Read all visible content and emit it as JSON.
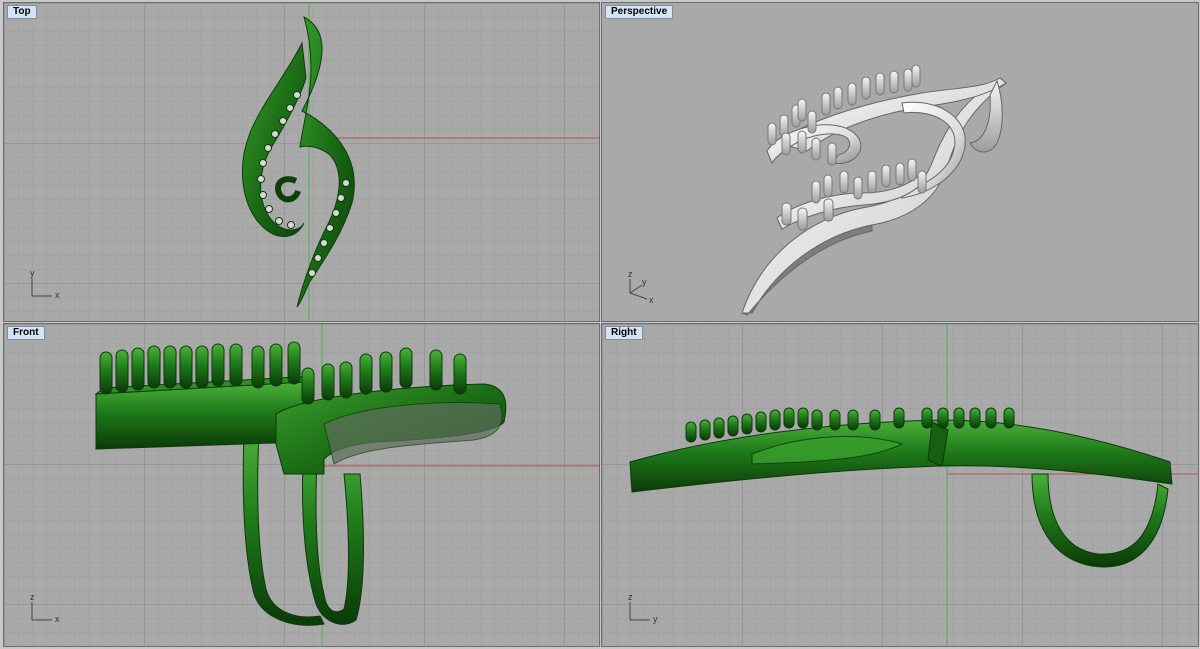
{
  "viewports": {
    "top": {
      "title": "Top",
      "axis_h": "x",
      "axis_v": "y"
    },
    "perspective": {
      "title": "Perspective",
      "axis_1": "z",
      "axis_2": "y",
      "axis_3": "x"
    },
    "front": {
      "title": "Front",
      "axis_h": "x",
      "axis_v": "z"
    },
    "right": {
      "title": "Right",
      "axis_h": "y",
      "axis_v": "z"
    }
  },
  "colors": {
    "viewport_bg": "#a9a9a9",
    "grid_minor": "#9c9c9c",
    "grid_major": "#8a8a8a",
    "axis_x": "#b85050",
    "axis_y": "#50a050",
    "model_shaded": "#1f7a1a",
    "model_render": "#e8e8e8"
  }
}
